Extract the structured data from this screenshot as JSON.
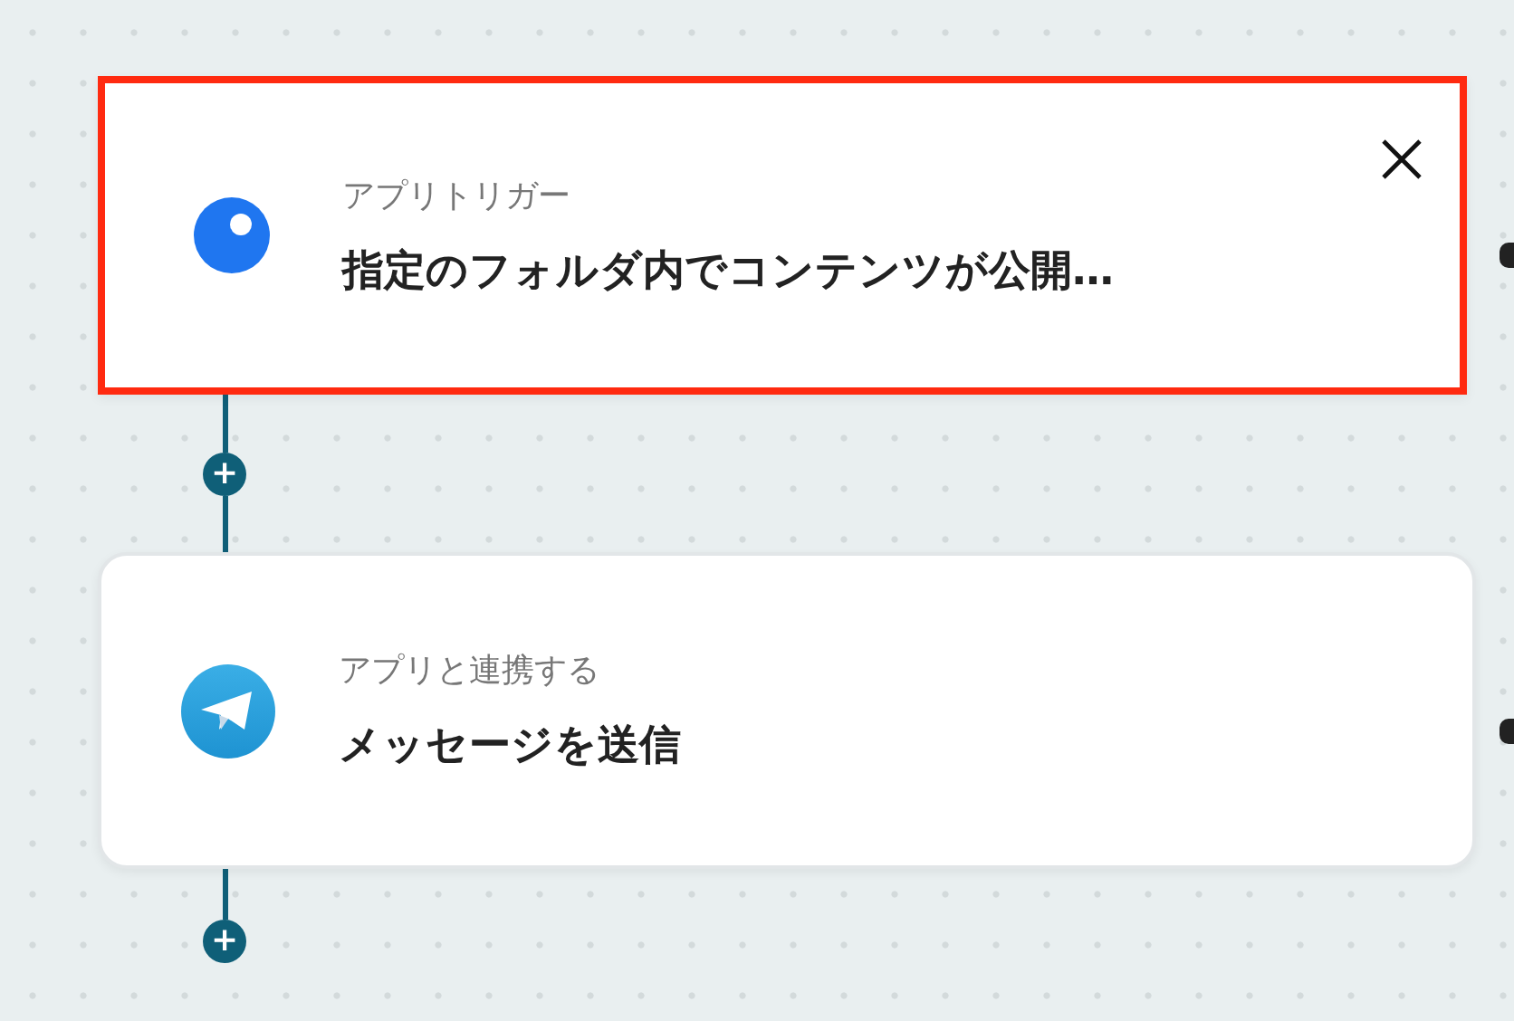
{
  "steps": [
    {
      "label": "アプリトリガー",
      "title": "指定のフォルダ内でコンテンツが公開…",
      "kind": "trigger",
      "highlighted": true,
      "closable": true
    },
    {
      "label": "アプリと連携する",
      "title": "メッセージを送信",
      "kind": "action",
      "highlighted": false,
      "closable": false
    }
  ],
  "add_buttons": [
    {
      "label": "+"
    },
    {
      "label": "+"
    }
  ]
}
